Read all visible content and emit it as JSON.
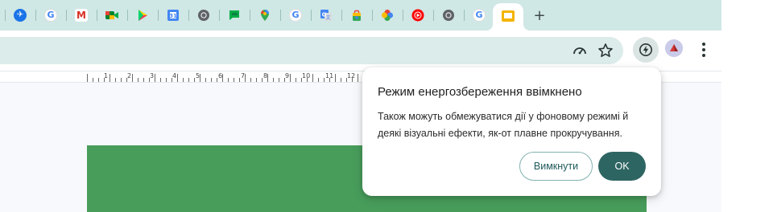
{
  "tabs": [
    {
      "icon": "app-icon"
    },
    {
      "icon": "google-icon"
    },
    {
      "icon": "gmail-icon"
    },
    {
      "icon": "meet-icon"
    },
    {
      "icon": "play-store-icon"
    },
    {
      "icon": "calendar-icon"
    },
    {
      "icon": "chrome-icon"
    },
    {
      "icon": "chat-icon"
    },
    {
      "icon": "maps-icon"
    },
    {
      "icon": "google-icon"
    },
    {
      "icon": "translate-icon"
    },
    {
      "icon": "shopping-icon"
    },
    {
      "icon": "photos-icon"
    },
    {
      "icon": "youtube-music-icon"
    },
    {
      "icon": "chrome-icon"
    },
    {
      "icon": "google-icon"
    },
    {
      "icon": "slides-icon"
    }
  ],
  "new_tab_label": "+",
  "ruler": {
    "labels": [
      "1",
      "2",
      "3",
      "4",
      "5",
      "6",
      "7",
      "8",
      "9",
      "10",
      "11",
      "12"
    ]
  },
  "popup": {
    "title": "Режим енергозбереження ввімкнено",
    "body": "Також можуть обмежуватися дії у фоновому режимі й деякі візуальні ефекти, як-от плавне прокручування.",
    "off_button": "Вимкнути",
    "ok_button": "OK"
  },
  "colors": {
    "tab_strip": "#cfe7e5",
    "omnibox": "#dcecea",
    "slide_fill": "#489d5b",
    "ok_button": "#2d6562",
    "off_button_border": "#82b3b1"
  }
}
